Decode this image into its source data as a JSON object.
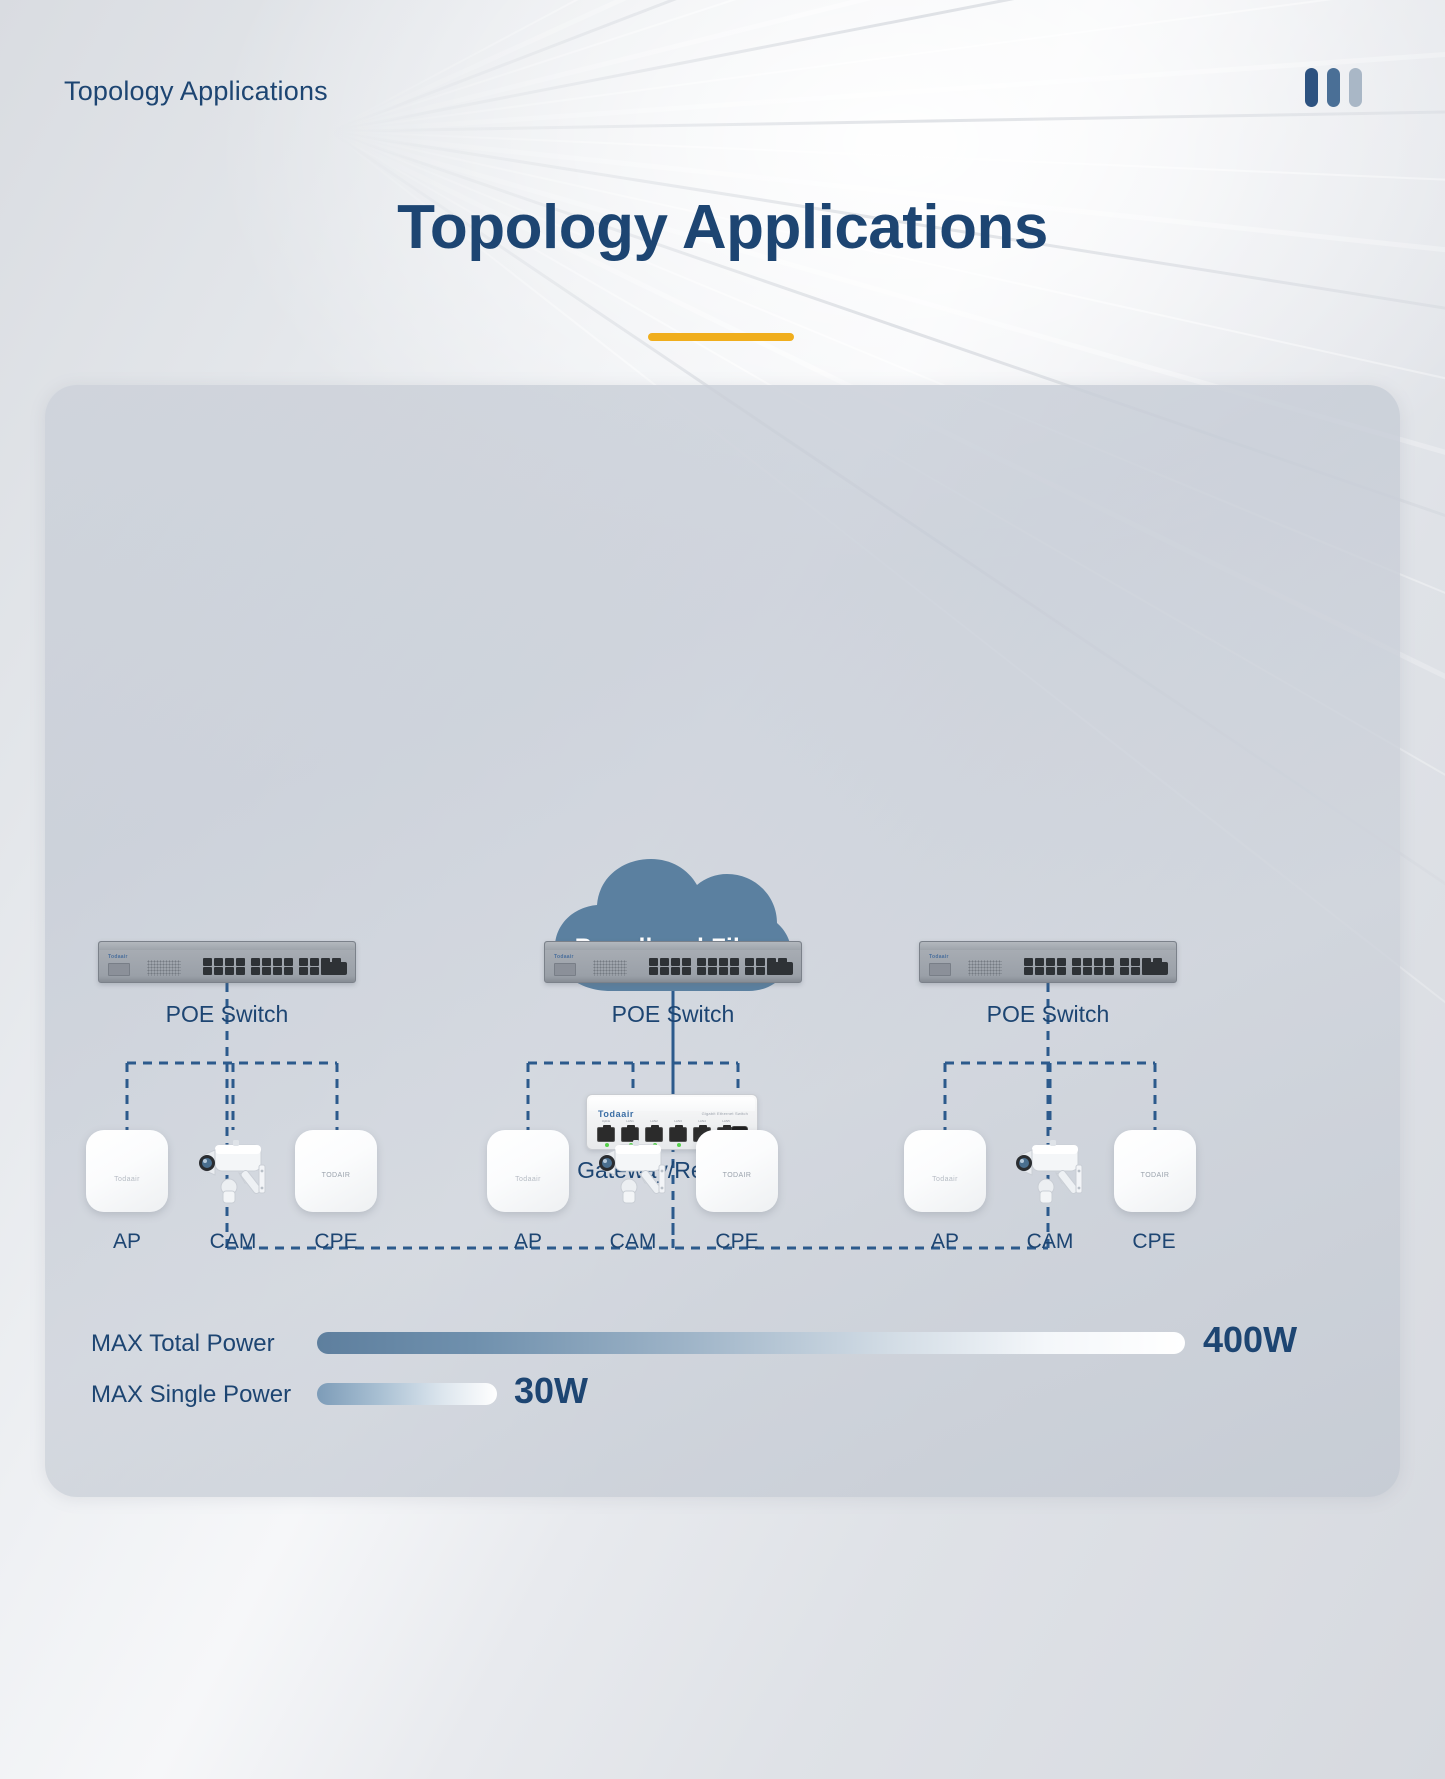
{
  "topbar": {
    "breadcrumb": "Topology Applications",
    "logo_bar_colors": [
      "#2d5280",
      "#4a6f96",
      "#a9b7c6"
    ]
  },
  "hero": {
    "title": "Topology Applications",
    "underline_color": "#f0ae1d"
  },
  "diagram": {
    "cloud": {
      "label": "Broadband Fiber",
      "fill_color": "#5b80a0"
    },
    "gateway": {
      "label": "Gateway/Repeater",
      "brand": "Todaair",
      "micro_text": "Gigabit Ethernet Switch",
      "port_labels": [
        "Uplink",
        "LAN1",
        "LAN2",
        "LAN3",
        "LAN4",
        "LAN5"
      ]
    },
    "switches": [
      {
        "label": "POE Switch",
        "brand": "Todaair"
      },
      {
        "label": "POE Switch",
        "brand": "Todaair"
      },
      {
        "label": "POE Switch",
        "brand": "Todaair"
      }
    ],
    "endpoint_groups": [
      {
        "endpoints": [
          {
            "label": "AP",
            "type": "ap",
            "brand": "Todaair"
          },
          {
            "label": "CAM",
            "type": "cam",
            "brand": ""
          },
          {
            "label": "CPE",
            "type": "cpe",
            "brand": "TODAIR"
          }
        ]
      },
      {
        "endpoints": [
          {
            "label": "AP",
            "type": "ap",
            "brand": "Todaair"
          },
          {
            "label": "CAM",
            "type": "cam",
            "brand": ""
          },
          {
            "label": "CPE",
            "type": "cpe",
            "brand": "TODAIR"
          }
        ]
      },
      {
        "endpoints": [
          {
            "label": "AP",
            "type": "ap",
            "brand": "Todaair"
          },
          {
            "label": "CAM",
            "type": "cam",
            "brand": ""
          },
          {
            "label": "CPE",
            "type": "cpe",
            "brand": "TODAIR"
          }
        ]
      }
    ],
    "connector_color": "#2f5party"
  },
  "power": {
    "total": {
      "label": "MAX Total Power",
      "value": "400W"
    },
    "single": {
      "label": "MAX Single Power",
      "value": "30W"
    }
  },
  "colors": {
    "navy": "#1d4572",
    "accent_orange": "#f0ae1d",
    "cloud_blue": "#5b80a0",
    "dash_blue": "#2c5a8c"
  }
}
